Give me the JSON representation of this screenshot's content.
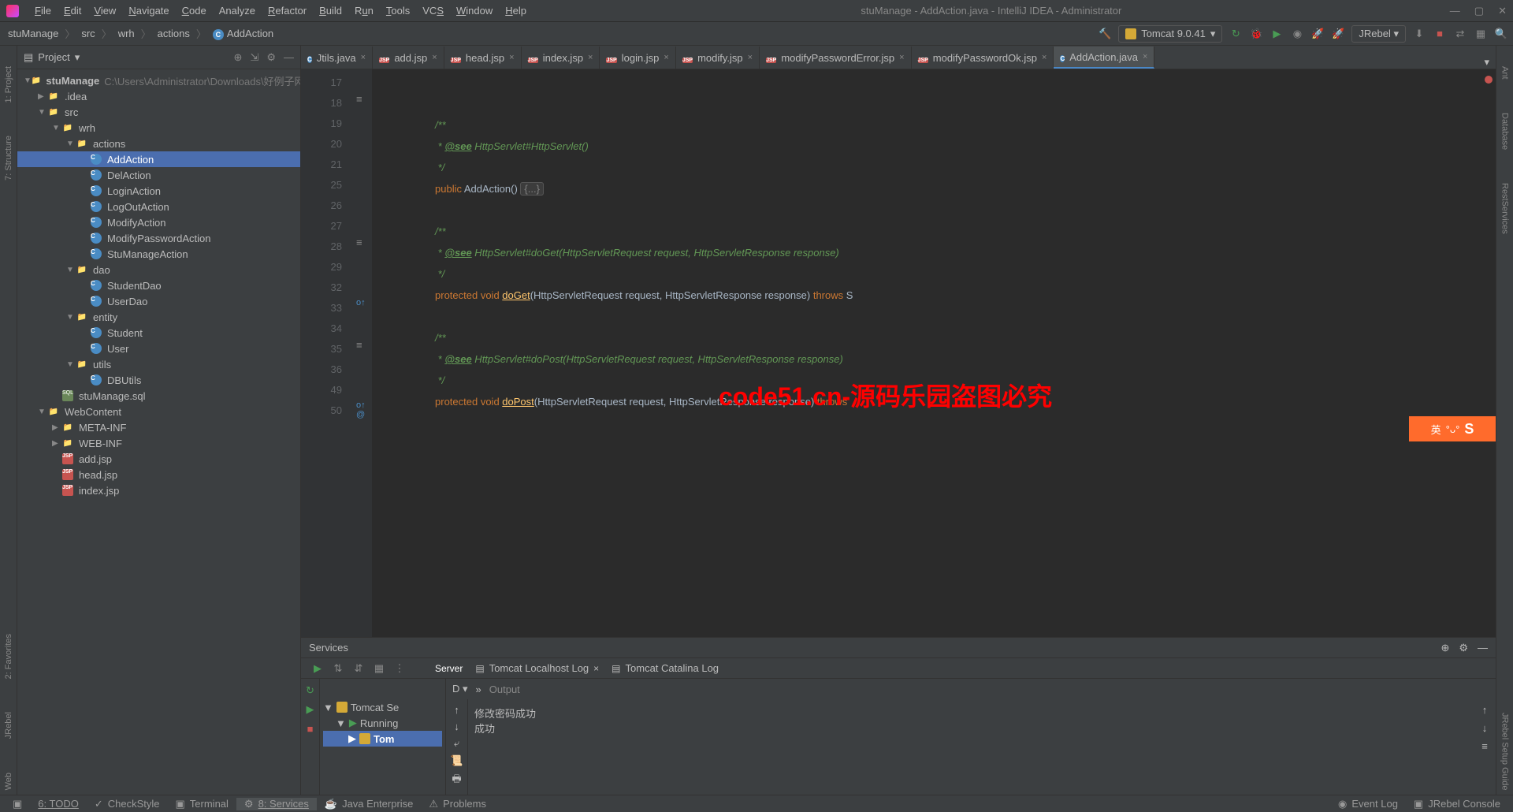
{
  "titlebar": {
    "menus": [
      {
        "label": "File",
        "u": 0
      },
      {
        "label": "Edit",
        "u": 0
      },
      {
        "label": "View",
        "u": 0
      },
      {
        "label": "Navigate",
        "u": 0
      },
      {
        "label": "Code",
        "u": 0
      },
      {
        "label": "Analyze",
        "u": -1
      },
      {
        "label": "Refactor",
        "u": 0
      },
      {
        "label": "Build",
        "u": 0
      },
      {
        "label": "Run",
        "u": 1
      },
      {
        "label": "Tools",
        "u": 0
      },
      {
        "label": "VCS",
        "u": 2
      },
      {
        "label": "Window",
        "u": 0
      },
      {
        "label": "Help",
        "u": 0
      }
    ],
    "title": "stuManage - AddAction.java - IntelliJ IDEA - Administrator"
  },
  "breadcrumbs": [
    "stuManage",
    "src",
    "wrh",
    "actions",
    "AddAction"
  ],
  "run_config": "Tomcat 9.0.41",
  "jrebel": "JRebel",
  "left_tabs": [
    "1: Project",
    "7: Structure"
  ],
  "left_tabs2": [
    "2: Favorites",
    "JRebel",
    "Web"
  ],
  "right_tabs": [
    "Ant",
    "Database",
    "RestServices",
    "JRebel Setup Guide"
  ],
  "project": {
    "title": "Project",
    "root": {
      "name": "stuManage",
      "path": "C:\\Users\\Administrator\\Downloads\\好例子网"
    },
    "tree": [
      {
        "indent": 1,
        "arrow": "▶",
        "icon": "folder",
        "label": ".idea"
      },
      {
        "indent": 1,
        "arrow": "▼",
        "icon": "folder",
        "label": "src"
      },
      {
        "indent": 2,
        "arrow": "▼",
        "icon": "folder",
        "label": "wrh"
      },
      {
        "indent": 3,
        "arrow": "▼",
        "icon": "folder",
        "label": "actions"
      },
      {
        "indent": 4,
        "arrow": "",
        "icon": "class",
        "label": "AddAction",
        "selected": true
      },
      {
        "indent": 4,
        "arrow": "",
        "icon": "class",
        "label": "DelAction"
      },
      {
        "indent": 4,
        "arrow": "",
        "icon": "class",
        "label": "LoginAction"
      },
      {
        "indent": 4,
        "arrow": "",
        "icon": "class",
        "label": "LogOutAction"
      },
      {
        "indent": 4,
        "arrow": "",
        "icon": "class",
        "label": "ModifyAction"
      },
      {
        "indent": 4,
        "arrow": "",
        "icon": "class",
        "label": "ModifyPasswordAction"
      },
      {
        "indent": 4,
        "arrow": "",
        "icon": "class",
        "label": "StuManageAction"
      },
      {
        "indent": 3,
        "arrow": "▼",
        "icon": "folder",
        "label": "dao"
      },
      {
        "indent": 4,
        "arrow": "",
        "icon": "class",
        "label": "StudentDao"
      },
      {
        "indent": 4,
        "arrow": "",
        "icon": "class",
        "label": "UserDao"
      },
      {
        "indent": 3,
        "arrow": "▼",
        "icon": "folder",
        "label": "entity"
      },
      {
        "indent": 4,
        "arrow": "",
        "icon": "class",
        "label": "Student"
      },
      {
        "indent": 4,
        "arrow": "",
        "icon": "class",
        "label": "User"
      },
      {
        "indent": 3,
        "arrow": "▼",
        "icon": "folder",
        "label": "utils"
      },
      {
        "indent": 4,
        "arrow": "",
        "icon": "class",
        "label": "DBUtils"
      },
      {
        "indent": 2,
        "arrow": "",
        "icon": "sql",
        "label": "stuManage.sql"
      },
      {
        "indent": 1,
        "arrow": "▼",
        "icon": "folder",
        "label": "WebContent"
      },
      {
        "indent": 2,
        "arrow": "▶",
        "icon": "folder",
        "label": "META-INF"
      },
      {
        "indent": 2,
        "arrow": "▶",
        "icon": "folder",
        "label": "WEB-INF"
      },
      {
        "indent": 2,
        "arrow": "",
        "icon": "jsp",
        "label": "add.jsp"
      },
      {
        "indent": 2,
        "arrow": "",
        "icon": "jsp",
        "label": "head.jsp"
      },
      {
        "indent": 2,
        "arrow": "",
        "icon": "jsp",
        "label": "index.jsp"
      }
    ]
  },
  "tabs": [
    {
      "icon": "class",
      "label": "Jtils.java"
    },
    {
      "icon": "jsp",
      "label": "add.jsp"
    },
    {
      "icon": "jsp",
      "label": "head.jsp"
    },
    {
      "icon": "jsp",
      "label": "index.jsp"
    },
    {
      "icon": "jsp",
      "label": "login.jsp"
    },
    {
      "icon": "jsp",
      "label": "modify.jsp"
    },
    {
      "icon": "jsp",
      "label": "modifyPasswordError.jsp"
    },
    {
      "icon": "jsp",
      "label": "modifyPasswordOk.jsp"
    },
    {
      "icon": "class",
      "label": "AddAction.java",
      "active": true
    }
  ],
  "code_lines": [
    "17",
    "18",
    "19",
    "20",
    "21",
    "25",
    "26",
    "27",
    "28",
    "29",
    "32",
    "33",
    "34",
    "35",
    "36",
    "49",
    "50"
  ],
  "code": {
    "l18": "/**",
    "l19a": " * ",
    "l19b": "@see",
    "l19c": " HttpServlet",
    "l19d": "#HttpServlet()",
    "l20": " */",
    "l21a": "public",
    "l21b": " AddAction() ",
    "l21c": "{...}",
    "l26": "/**",
    "l27a": " * ",
    "l27b": "@see",
    "l27c": " HttpServlet",
    "l27d": "#doGet(HttpServletRequest request, HttpServletResponse response)",
    "l28": " */",
    "l29a": "protected void ",
    "l29b": "doGet",
    "l29c": "(HttpServletRequest request, HttpServletResponse response) ",
    "l29d": "throws ",
    "l29e": "S",
    "l33": "/**",
    "l34a": " * ",
    "l34b": "@see",
    "l34c": " HttpServlet",
    "l34d": "#doPost(HttpServletRequest request, HttpServletResponse response)",
    "l35": " */",
    "l36a": "protected void ",
    "l36b": "doPost",
    "l36c": "(HttpServletRequest request, HttpServletResponse response) ",
    "l36d": "throws"
  },
  "watermark": "code51.cn-源码乐园盗图必究",
  "ime": "英",
  "services": {
    "title": "Services",
    "tabs": [
      "Server",
      "Tomcat Localhost Log",
      "Tomcat Catalina Log"
    ],
    "tree_root": "Tomcat Se",
    "tree_running": "Running",
    "tree_item": "Tom",
    "d_label": "D",
    "output_label": "Output",
    "output_lines": [
      "修改密码成功",
      "成功"
    ]
  },
  "statusbar": {
    "items": [
      "6: TODO",
      "CheckStyle",
      "Terminal",
      "8: Services",
      "Java Enterprise",
      "Problems"
    ],
    "right": [
      "Event Log",
      "JRebel Console"
    ]
  }
}
